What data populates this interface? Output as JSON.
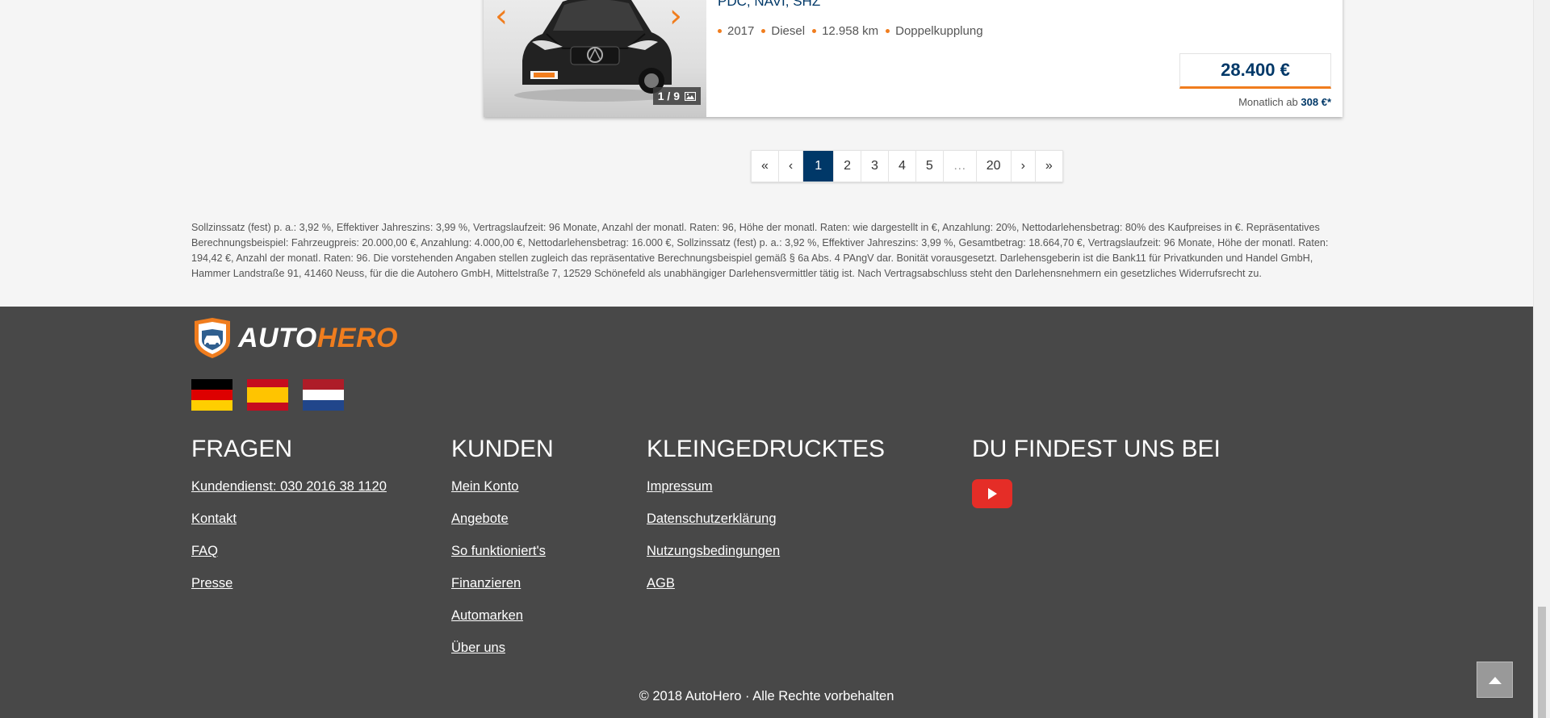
{
  "listing": {
    "title": "PDC, NAVI, SHZ",
    "image_counter": "1 / 9",
    "specs": [
      "2017",
      "Diesel",
      "12.958 km",
      "Doppelkupplung"
    ],
    "price": "28.400 €",
    "monthly_prefix": "Monatlich ab",
    "monthly_amount": "308 €*",
    "accent_color": "#f07d1e",
    "brand_color": "#003868"
  },
  "pagination": {
    "first": "«",
    "prev": "‹",
    "pages": [
      "1",
      "2",
      "3",
      "4",
      "5"
    ],
    "ellipsis": "…",
    "last_page": "20",
    "next": "›",
    "last": "»",
    "current": "1"
  },
  "disclaimer": "Sollzinssatz (fest) p. a.: 3,92 %, Effektiver Jahreszins: 3,99 %, Vertragslaufzeit: 96 Monate, Anzahl der monatl. Raten: 96, Höhe der monatl. Raten: wie dargestellt in €, Anzahlung: 20%, Nettodarlehensbetrag: 80% des Kaufpreises in €. Repräsentatives Berechnungsbeispiel: Fahrzeugpreis: 20.000,00 €, Anzahlung: 4.000,00 €, Nettodarlehensbetrag: 16.000 €, Sollzinssatz (fest) p. a.: 3,92 %, Effektiver Jahreszins: 3,99 %, Gesamtbetrag: 18.664,70 €, Vertragslaufzeit: 96 Monate, Höhe der monatl. Raten: 194,42 €, Anzahl der monatl. Raten: 96. Die vorstehenden Angaben stellen zugleich das repräsentative Berechnungsbeispiel gemäß § 6a Abs. 4 PAngV dar. Bonität vorausgesetzt. Darlehensgeberin ist die Bank11 für Privatkunden und Handel GmbH, Hammer Landstraße 91, 41460 Neuss, für die die Autohero GmbH, Mittelstraße 7, 12529 Schönefeld als unabhängiger Darlehensvermittler tätig ist. Nach Vertragsabschluss steht den  Darlehensnehmern ein gesetzliches Widerrufsrecht zu.",
  "footer": {
    "logo": {
      "auto": "AUTO",
      "hero": "HERO"
    },
    "flags": [
      "de",
      "es",
      "nl"
    ],
    "columns": [
      {
        "title": "FRAGEN",
        "links": [
          "Kundendienst: 030 2016 38 1120",
          "Kontakt",
          "FAQ",
          "Presse"
        ]
      },
      {
        "title": "KUNDEN",
        "links": [
          "Mein Konto",
          "Angebote",
          "So funktioniert's",
          "Finanzieren",
          "Automarken",
          "Über uns"
        ]
      },
      {
        "title": "KLEINGEDRUCKTES",
        "links": [
          "Impressum",
          "Datenschutzerklärung",
          "Nutzungsbedingungen",
          "AGB"
        ]
      },
      {
        "title": "DU FINDEST UNS BEI",
        "social": [
          "youtube-icon"
        ]
      }
    ],
    "copyright": "© 2018 AutoHero · Alle Rechte vorbehalten",
    "background": "#484848"
  }
}
